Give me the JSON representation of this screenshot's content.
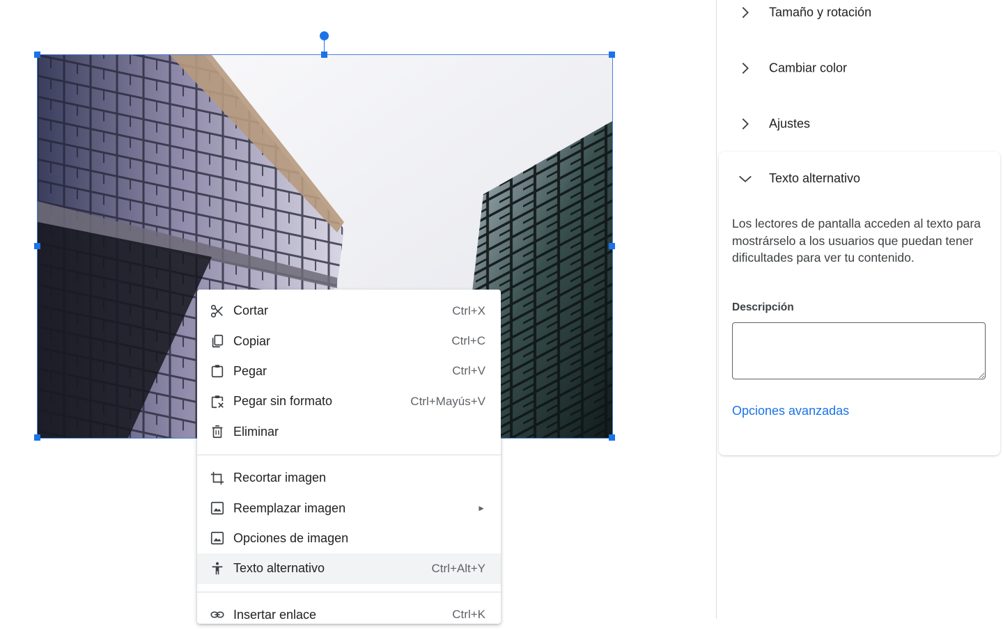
{
  "context_menu": {
    "items": [
      {
        "label": "Cortar",
        "shortcut": "Ctrl+X",
        "icon": "scissors-icon"
      },
      {
        "label": "Copiar",
        "shortcut": "Ctrl+C",
        "icon": "copy-icon"
      },
      {
        "label": "Pegar",
        "shortcut": "Ctrl+V",
        "icon": "clipboard-icon"
      },
      {
        "label": "Pegar sin formato",
        "shortcut": "Ctrl+Mayús+V",
        "icon": "paste-plain-icon"
      },
      {
        "label": "Eliminar",
        "shortcut": "",
        "icon": "trash-icon"
      },
      {
        "label": "Recortar imagen",
        "shortcut": "",
        "icon": "crop-icon"
      },
      {
        "label": "Reemplazar imagen",
        "shortcut": "",
        "icon": "image-icon",
        "submenu": true
      },
      {
        "label": "Opciones de imagen",
        "shortcut": "",
        "icon": "image-icon"
      },
      {
        "label": "Texto alternativo",
        "shortcut": "Ctrl+Alt+Y",
        "icon": "accessibility-icon",
        "highlighted": true
      },
      {
        "label": "Insertar enlace",
        "shortcut": "Ctrl+K",
        "icon": "link-icon"
      }
    ],
    "submenu_arrow": "►"
  },
  "side_panel": {
    "sections": [
      {
        "title": "Tamaño y rotación",
        "expanded": false
      },
      {
        "title": "Cambiar color",
        "expanded": false
      },
      {
        "title": "Ajustes",
        "expanded": false
      }
    ],
    "alt_text": {
      "title": "Texto alternativo",
      "expanded": true,
      "description": "Los lectores de pantalla acceden al texto para mostrárselo a los usuarios que puedan tener dificultades para ver tu contenido.",
      "field_label": "Descripción",
      "field_value": "",
      "advanced_link": "Opciones avanzadas"
    }
  },
  "colors": {
    "accent": "#1a73e8",
    "highlight": "#f1f3f4",
    "divider": "#dadce0"
  }
}
